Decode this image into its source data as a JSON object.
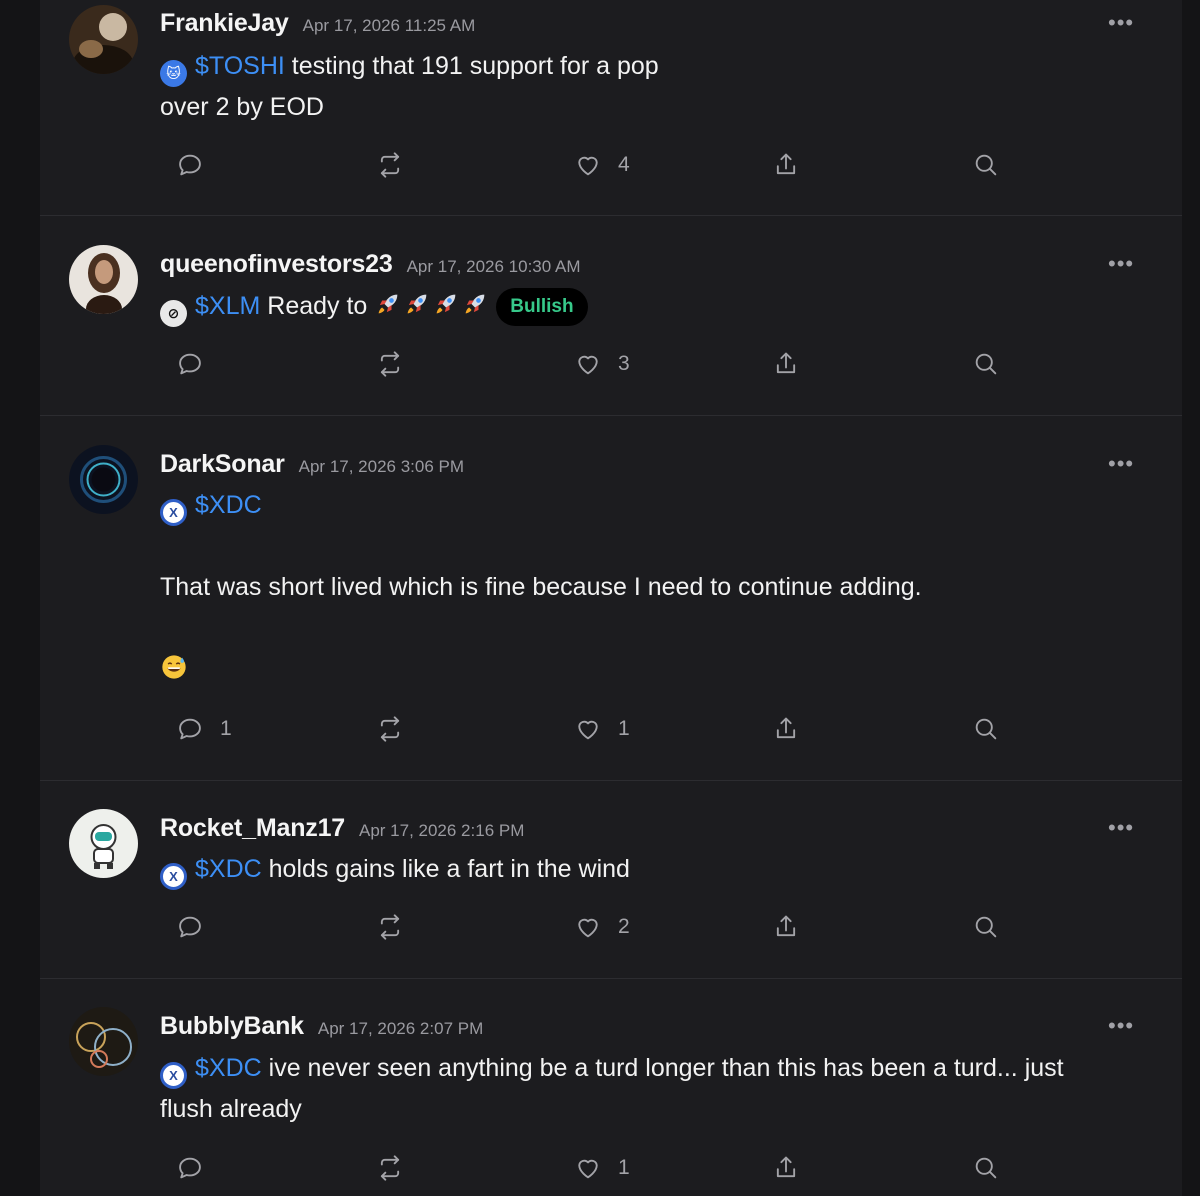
{
  "posts": [
    {
      "username": "FrankieJay",
      "timestamp": "Apr 17, 2026 11:25 AM",
      "ticker": "$TOSHI",
      "text_line1": " testing that 191 support for a pop",
      "text_line2": "over 2 by EOD",
      "comments": "",
      "likes": "4"
    },
    {
      "username": "queenofinvestors23",
      "timestamp": "Apr 17, 2026 10:30 AM",
      "ticker": "$XLM",
      "text": " Ready to ",
      "sentiment": "Bullish",
      "comments": "",
      "likes": "3"
    },
    {
      "username": "DarkSonar",
      "timestamp": "Apr 17, 2026 3:06 PM",
      "ticker": "$XDC",
      "text": "That was short lived which is fine because I need to continue adding.",
      "comments": "1",
      "likes": "1"
    },
    {
      "username": "Rocket_Manz17",
      "timestamp": "Apr 17, 2026 2:16 PM",
      "ticker": "$XDC",
      "text": " holds gains like a fart in the wind",
      "comments": "",
      "likes": "2"
    },
    {
      "username": "BubblyBank",
      "timestamp": "Apr 17, 2026 2:07 PM",
      "ticker": "$XDC",
      "text_line1": " ive never seen anything be a turd longer than this has been a turd...  just",
      "text_line2": "flush already",
      "comments": "",
      "likes": "1"
    }
  ],
  "more_label": "•••",
  "icons": [
    "comment-icon",
    "repost-icon",
    "heart-icon",
    "share-icon",
    "search-icon",
    "more-icon",
    "coin-icon",
    "rocket-emoji",
    "grinning-sweat-emoji"
  ],
  "colors": {
    "background": "#141416",
    "card": "#1c1c1f",
    "ticker": "#3d8ff5",
    "bullish_text": "#37c98a",
    "muted": "#9a9aa0"
  }
}
